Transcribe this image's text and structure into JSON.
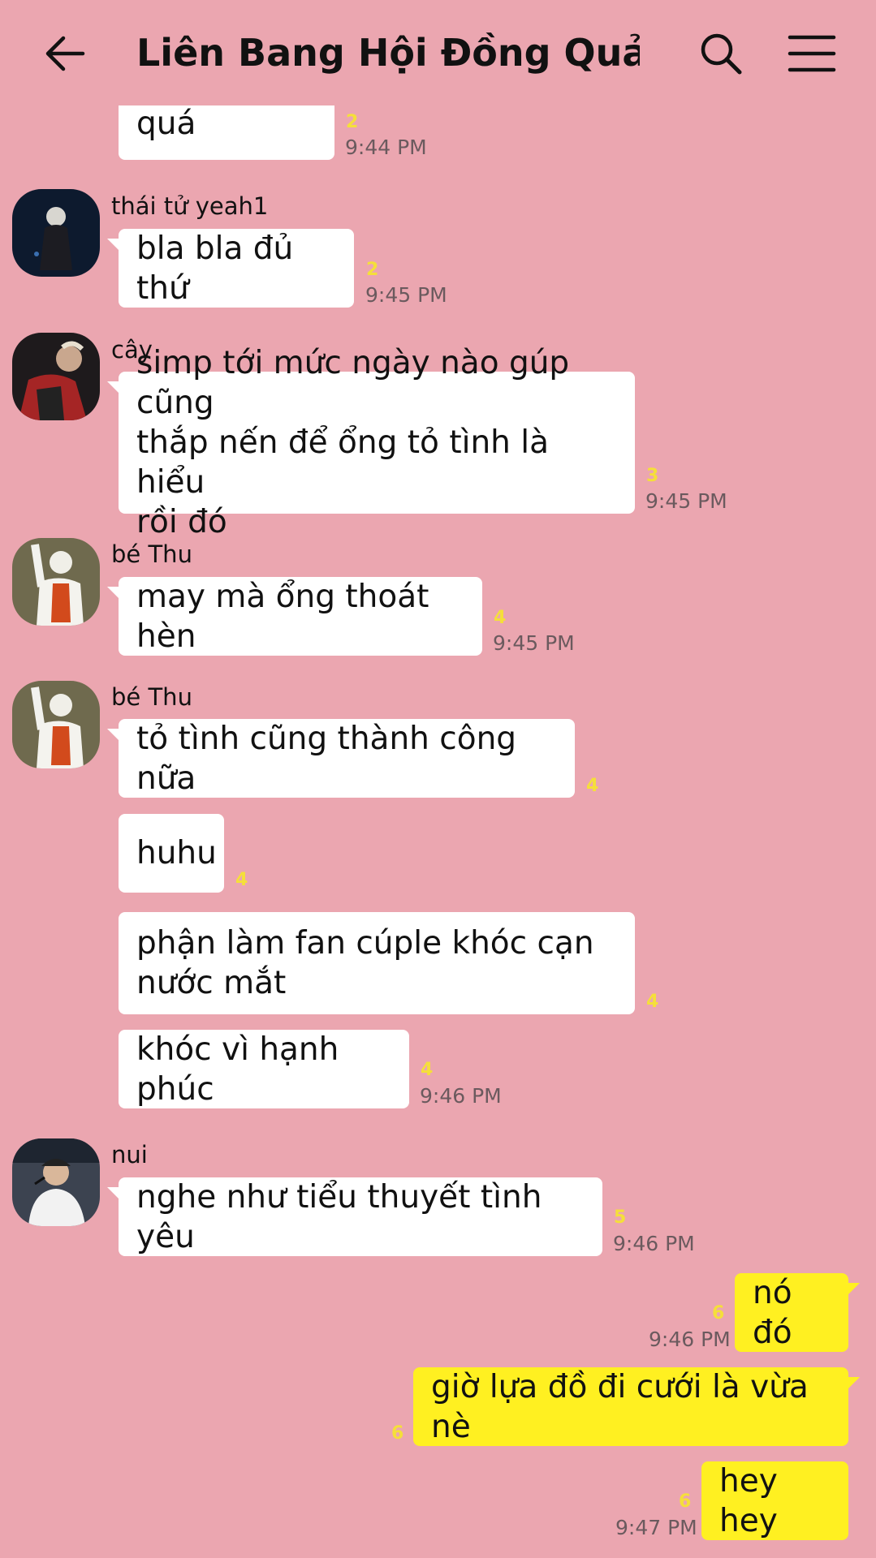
{
  "header": {
    "title": "Liên Bang Hội Đồng Quản...",
    "back_icon": "arrow-left-icon",
    "search_icon": "search-icon",
    "menu_icon": "hamburger-menu-icon"
  },
  "colors": {
    "background": "#eba6b0",
    "incoming_bubble": "#ffffff",
    "outgoing_bubble": "#fff021",
    "unread_count": "#f5df3a"
  },
  "messages": [
    {
      "text": "đẹp trai quá",
      "count": "2",
      "time": "9:44 PM"
    },
    {
      "sender": "thái tử yeah1",
      "text": "bla bla đủ thứ",
      "count": "2",
      "time": "9:45 PM"
    },
    {
      "sender": "cây",
      "lines": [
        "simp tới mức ngày nào gúp cũng",
        "thắp nến để ổng tỏ tình là hiểu",
        "rồi đó"
      ],
      "count": "3",
      "time": "9:45 PM"
    },
    {
      "sender": "bé Thu",
      "text": "may mà ổng thoát hèn",
      "count": "4",
      "time": "9:45 PM"
    },
    {
      "sender": "bé Thu",
      "text": "tỏ tình cũng thành công nữa",
      "count": "4"
    },
    {
      "text": "huhu",
      "count": "4"
    },
    {
      "lines": [
        "phận làm fan cúple khóc cạn",
        "nước mắt"
      ],
      "count": "4"
    },
    {
      "text": "khóc vì hạnh phúc",
      "count": "4",
      "time": "9:46 PM"
    },
    {
      "sender": "nui",
      "text": "nghe như tiểu thuyết tình yêu",
      "count": "5",
      "time": "9:46 PM"
    },
    {
      "text": "nó đó",
      "count": "6",
      "time": "9:46 PM"
    },
    {
      "text": "giờ lựa đồ đi cưới là vừa nè",
      "count": "6"
    },
    {
      "text": "hey hey",
      "count": "6",
      "time": "9:47 PM"
    }
  ]
}
